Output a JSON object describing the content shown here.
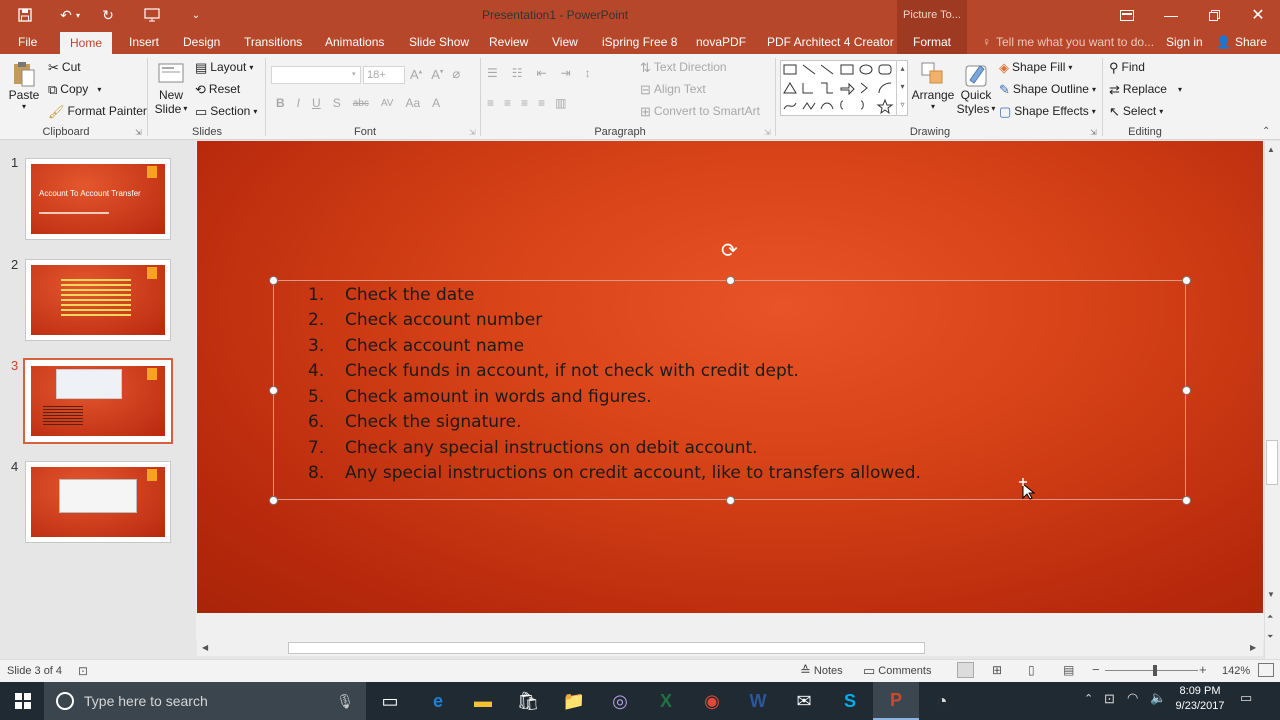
{
  "title_bar": {
    "document_title": "Presentation1 - PowerPoint",
    "context_tab_title": "Picture To...",
    "quick_access": [
      "save-icon",
      "undo-icon",
      "redo-icon",
      "present-icon",
      "customize-icon"
    ],
    "window_buttons": [
      "ribbon-display-icon",
      "minimize-icon",
      "maximize-icon",
      "close-icon"
    ]
  },
  "tabs": {
    "file": "File",
    "home": "Home",
    "insert": "Insert",
    "design": "Design",
    "transitions": "Transitions",
    "animations": "Animations",
    "slide_show": "Slide Show",
    "review": "Review",
    "view": "View",
    "ispring": "iSpring Free 8",
    "novapdf": "novaPDF",
    "pdf_architect": "PDF Architect 4 Creator",
    "format": "Format",
    "tell_me": "Tell me what you want to do...",
    "sign_in": "Sign in",
    "share": "Share"
  },
  "ribbon": {
    "clipboard": {
      "paste": "Paste",
      "cut": "Cut",
      "copy": "Copy",
      "format_painter": "Format Painter",
      "label": "Clipboard"
    },
    "slides": {
      "new_slide_1": "New",
      "new_slide_2": "Slide",
      "layout": "Layout",
      "reset": "Reset",
      "section": "Section",
      "label": "Slides"
    },
    "font": {
      "font_name": "",
      "font_size": "18+",
      "label": "Font"
    },
    "paragraph": {
      "text_direction": "Text Direction",
      "align_text": "Align Text",
      "convert_smartart": "Convert to SmartArt",
      "label": "Paragraph"
    },
    "drawing": {
      "arrange": "Arrange",
      "quick_styles_1": "Quick",
      "quick_styles_2": "Styles",
      "shape_fill": "Shape Fill",
      "shape_outline": "Shape Outline",
      "shape_effects": "Shape Effects",
      "label": "Drawing"
    },
    "editing": {
      "find": "Find",
      "replace": "Replace",
      "select": "Select",
      "label": "Editing"
    }
  },
  "slides_pane": {
    "numbers": [
      "1",
      "2",
      "3",
      "4"
    ],
    "thumb1_title": "Account To Account Transfer",
    "selected": "3"
  },
  "slide": {
    "items": [
      {
        "n": "1.",
        "text": "Check the date"
      },
      {
        "n": "2.",
        "text": "Check account number"
      },
      {
        "n": "3.",
        "text": "Check account name"
      },
      {
        "n": "4.",
        "text": "Check funds in account, if not check with credit dept."
      },
      {
        "n": "5.",
        "text": "Check amount in words and figures."
      },
      {
        "n": "6.",
        "text": "Check the signature."
      },
      {
        "n": "7.",
        "text": "Check any special instructions on debit account."
      },
      {
        "n": "8.",
        "text": "Any special instructions on credit account, like to transfers allowed."
      }
    ]
  },
  "status_bar": {
    "slide_info": "Slide 3 of 4",
    "notes": "Notes",
    "comments": "Comments",
    "zoom": "142%"
  },
  "taskbar": {
    "search_placeholder": "Type here to search",
    "time": "8:09 PM",
    "date": "9/23/2017"
  },
  "colors": {
    "accent": "#b7472a",
    "slide_bg": "#d84418",
    "thumb_tag": "#f6a321"
  }
}
